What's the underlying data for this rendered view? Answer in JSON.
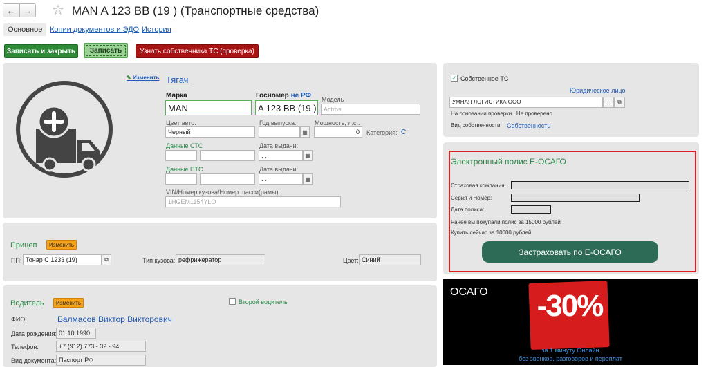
{
  "header": {
    "back_icon": "←",
    "forward_icon": "→",
    "star_icon": "☆",
    "title": "MAN A 123 BB (19 ) (Транспортные средства)"
  },
  "tabs": [
    {
      "label": "Основное"
    },
    {
      "label": "Копии документов и ЭДО"
    },
    {
      "label": "История"
    }
  ],
  "toolbar": {
    "save_close": "Записать и закрыть",
    "save": "Записать",
    "check_owner": "Узнать собственника ТС (проверка)"
  },
  "tractor": {
    "edit_label": "Изменить",
    "title": "Тягач",
    "brand_label": "Марка",
    "brand_value": "MAN",
    "plate_label": "Госномер",
    "plate_suffix": "не РФ",
    "plate_value": "A 123 BB (19 )",
    "model_label": "Модель",
    "model_placeholder": "Actros",
    "color_label": "Цвет авто:",
    "color_value": "Черный",
    "year_label": "Год выпуска:",
    "power_label": "Мощность, л.с.:",
    "power_value": "0",
    "category_label": "Категория:",
    "category_value": "С",
    "sts_label": "Данные СТС",
    "sts_date_label": "Дата выдачи:",
    "sts_date_value": " .  .",
    "pts_label": "Данные ПТС",
    "pts_date_label": "Дата выдачи:",
    "pts_date_value": " .  .",
    "vin_label": "VIN/Номер кузова/Номер шасси(рамы):",
    "vin_placeholder": "1HGEM1154YLO"
  },
  "trailer": {
    "title": "Прицеп",
    "edit_label": "Изменить",
    "pp_label": "ПП:",
    "pp_value": "Тонар С 1233 (19)",
    "body_label": "Тип кузова:",
    "body_value": "рефрижератор",
    "color_label": "Цвет:",
    "color_value": "Синий"
  },
  "driver": {
    "title": "Водитель",
    "edit_label": "Изменить",
    "second_driver_label": "Второй водитель",
    "name_label": "ФИО:",
    "name_value": "Балмасов Виктор Викторович",
    "birth_label": "Дата рождения:",
    "birth_value": "01.10.1990",
    "phone_label": "Телефон:",
    "phone_value": "+7 (912) 773 - 32 - 94",
    "doc_label": "Вид документа:",
    "doc_value": "Паспорт РФ"
  },
  "ownership": {
    "own_label": "Собственное ТС",
    "own_checked": true,
    "legal_entity_link": "Юридическое лицо",
    "company_value": "УМНАЯ ЛОГИСТИКА ООО",
    "check_text": "На основании проверки : Не проверено",
    "ownership_type_label": "Вид собственности:",
    "ownership_type_value": "Собственность"
  },
  "osago_form": {
    "title": "Электронный полис Е-ОСАГО",
    "insurer_label": "Страховая компания:",
    "series_label": "Серия и Номер:",
    "date_label": "Дата полиса:",
    "prev_text": "Ранее вы покупали полис за 15000 рублей",
    "now_text": "Купить сейчас за 10000 рублей",
    "button_label": "Застраховать по Е-ОСАГО"
  },
  "banner": {
    "title": "ОСАГО",
    "discount": "-30%",
    "line1": "за 1 минуту Онлайн",
    "line2": "без звонков, разговоров и переплат"
  },
  "colors": {
    "accent_green": "#2f8a37",
    "accent_red": "#a81414",
    "osago_button": "#2e6b57",
    "highlight_border": "#e02020",
    "banner_bg": "#000000",
    "badge_red": "#d61c1c"
  }
}
